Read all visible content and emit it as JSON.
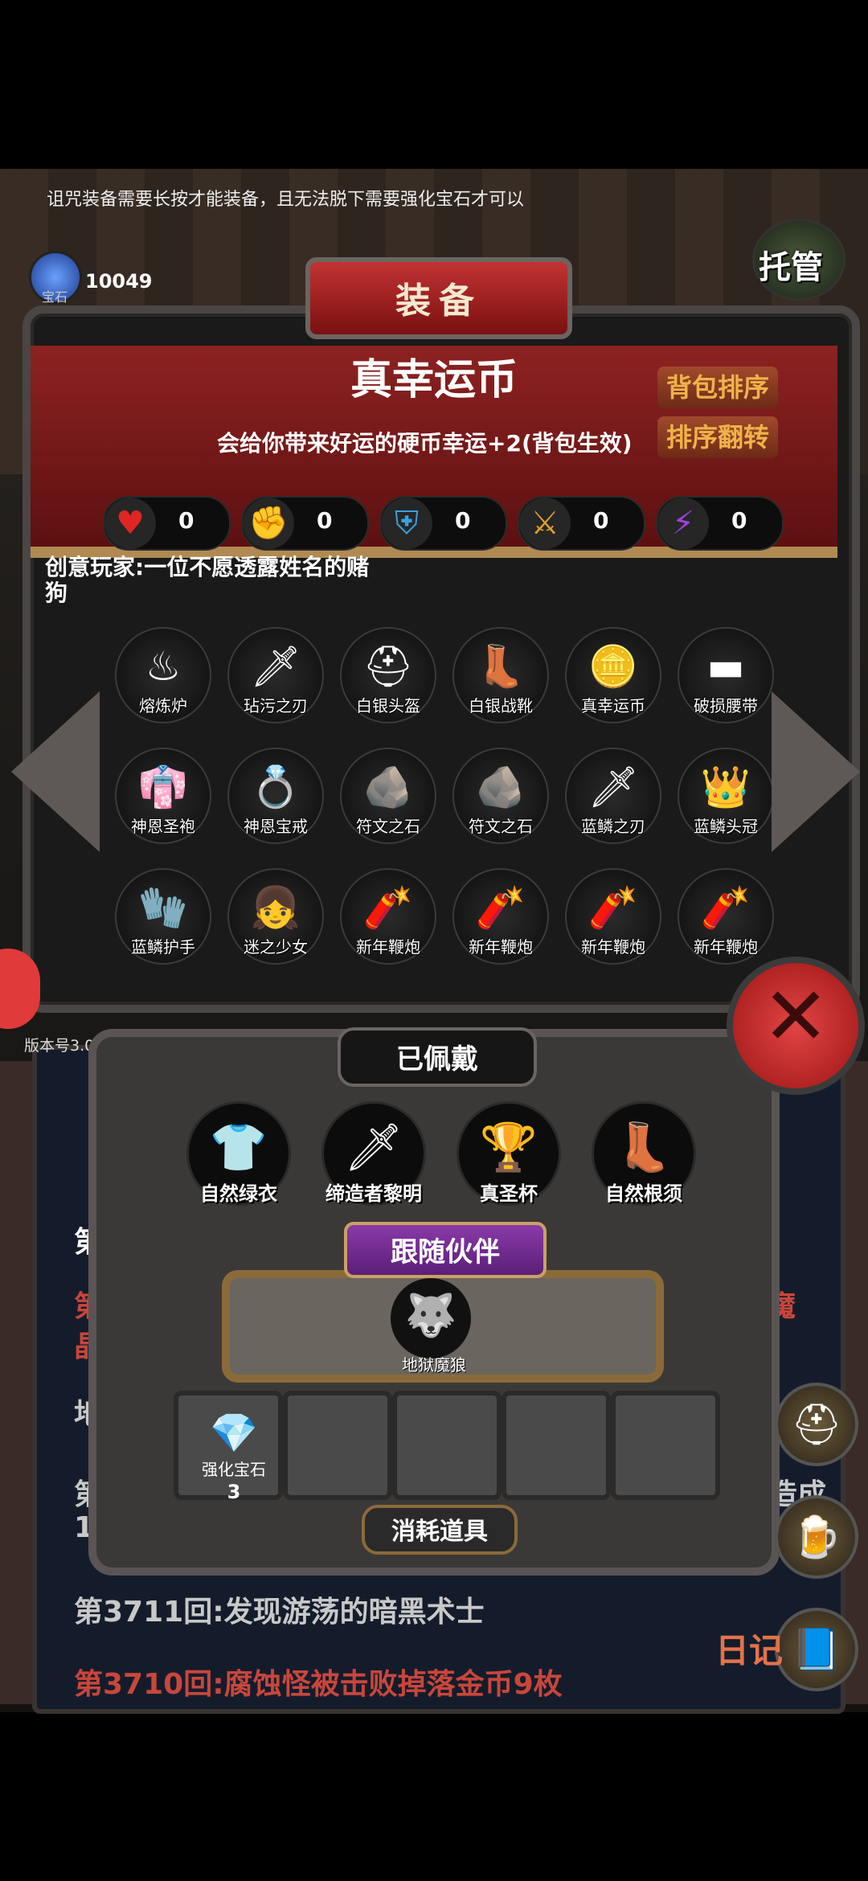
{
  "top_tip": "诅咒装备需要长按才能装备，且无法脱下需要强化宝石才可以",
  "gems": {
    "label": "宝石",
    "count": "10049",
    "icon": "blue-gem-icon"
  },
  "auto_button": {
    "label": "托管"
  },
  "panel": {
    "title": "装备"
  },
  "selected_item": {
    "name": "真幸运币",
    "description": "会给你带来好运的硬币幸运+2(背包生效)"
  },
  "sort_buttons": {
    "sort": "背包排序",
    "reverse": "排序翻转"
  },
  "stats": [
    {
      "icon": "heart-icon",
      "glyph": "♥",
      "value": "0",
      "color": "#e02525"
    },
    {
      "icon": "strength-icon",
      "glyph": "✊",
      "value": "0",
      "color": "#f0c030"
    },
    {
      "icon": "armor-icon",
      "glyph": "⛨",
      "value": "0",
      "color": "#3aa0e0"
    },
    {
      "icon": "sword-icon",
      "glyph": "⚔",
      "value": "0",
      "color": "#e0a030"
    },
    {
      "icon": "lightning-icon",
      "glyph": "⚡",
      "value": "0",
      "color": "#a040e0"
    }
  ],
  "creator_note": "创意玩家:一位不愿透露姓名的赌狗",
  "inventory": [
    {
      "name": "熔炼炉",
      "glyph": "♨"
    },
    {
      "name": "玷污之刃",
      "glyph": "🗡"
    },
    {
      "name": "白银头盔",
      "glyph": "⛑"
    },
    {
      "name": "白银战靴",
      "glyph": "👢"
    },
    {
      "name": "真幸运币",
      "glyph": "🪙"
    },
    {
      "name": "破损腰带",
      "glyph": "▬"
    },
    {
      "name": "神恩圣袍",
      "glyph": "👘"
    },
    {
      "name": "神恩宝戒",
      "glyph": "💍"
    },
    {
      "name": "符文之石",
      "glyph": "🪨"
    },
    {
      "name": "符文之石",
      "glyph": "🪨"
    },
    {
      "name": "蓝鳞之刃",
      "glyph": "🗡"
    },
    {
      "name": "蓝鳞头冠",
      "glyph": "👑"
    },
    {
      "name": "蓝鳞护手",
      "glyph": "🧤"
    },
    {
      "name": "迷之少女",
      "glyph": "👧"
    },
    {
      "name": "新年鞭炮",
      "glyph": "🧨"
    },
    {
      "name": "新年鞭炮",
      "glyph": "🧨"
    },
    {
      "name": "新年鞭炮",
      "glyph": "🧨"
    },
    {
      "name": "新年鞭炮",
      "glyph": "🧨"
    }
  ],
  "version": "版本号3.08",
  "worn": {
    "title": "已佩戴",
    "items": [
      {
        "name": "自然绿衣",
        "glyph": "👕"
      },
      {
        "name": "缔造者黎明",
        "glyph": "🗡"
      },
      {
        "name": "真圣杯",
        "glyph": "🏆"
      },
      {
        "name": "自然根须",
        "glyph": "👢"
      }
    ]
  },
  "companion": {
    "title": "跟随伙伴",
    "name": "地狱魔狼",
    "glyph": "🐺"
  },
  "consumables": {
    "title": "消耗道具",
    "items": [
      {
        "name": "强化宝石",
        "count": "3",
        "glyph": "💎"
      }
    ]
  },
  "log": {
    "lines": [
      "第",
      "第",
      "魔",
      "晶",
      "地",
      "第",
      "1",
      "造成",
      "第3711回:发现游荡的暗黑术士",
      "第3710回:腐蚀怪被击败掉落金币9枚"
    ],
    "diary_label": "日记"
  }
}
